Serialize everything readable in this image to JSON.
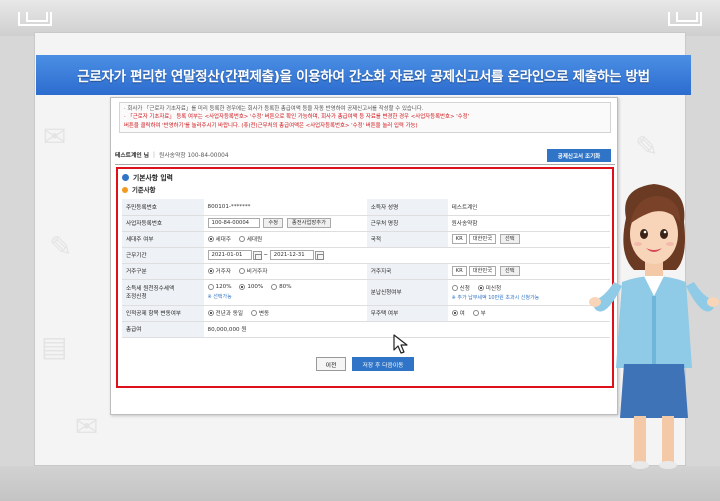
{
  "banner": {
    "title": "근로자가 편리한 연말정산(간편제출)을 이용하여 간소화 자료와 공제신고서를 온라인으로 제출하는 방법"
  },
  "notice": {
    "line1": "· 회사가 「근로자 기초자료」를 미리 등록한 경우에는 회사가 등록한 총급여액 등을 자동 반영하여 공제신고서를 작성할 수 있습니다.",
    "line2_red": "· 「근로자 기초자료」 등록 여부는 <사업자등록번호> '수정' 버튼으로 확인 가능",
    "line2_rest": "하며, 회사가 총급여액 등 자료를 변경한 경우 <사업자등록번호> '수정'",
    "line3": "버튼을 클릭하여 '반영하기'를 눌러주시기 바랍니다. (휴(전)근무처의 총급여액은 <사업자등록번호> '수정' 버튼을 눌러 입력 가능)"
  },
  "business": {
    "name": "테스트계인 님",
    "number": "원사송약함 100-84-00004",
    "button": "공제신고서 조기화"
  },
  "form": {
    "section_title": "기본사항 입력",
    "subsection_title": "기준사항",
    "rows": {
      "rrn_label": "주민등록번호",
      "rrn_value": "800101-*******",
      "company_name_label": "소득자 성명",
      "company_name_value": "테스트계인",
      "bizno_label": "사업자등록번호",
      "bizno_value": "100-84-00004",
      "edit_button": "수정",
      "add_prev_button": "종전사업장추가",
      "workplace_label": "근무처 명칭",
      "workplace_value": "원사송약함",
      "household_label": "세대주 여부",
      "household_opt1": "세대주",
      "household_opt2": "세대원",
      "nationality_label": "국적",
      "nationality_code": "KR",
      "nationality_name": "대한민국",
      "select_button": "선택",
      "period_label": "근무기간",
      "period_start": "2021-01-01",
      "period_tilde": "~",
      "period_end": "2021-12-31",
      "residence_label": "거주구분",
      "residence_opt1": "거주자",
      "residence_opt2": "비거주자",
      "residence_country_label": "거주지국",
      "residence_country_code": "KR",
      "residence_country_name": "대한민국",
      "residence_select_button": "선택",
      "tax_label_line1": "소득세 원천징수세액",
      "tax_label_line2": "조정신청",
      "tax_opt1": "120%",
      "tax_opt2": "100%",
      "tax_opt3": "80%",
      "tax_note": "※ 선택가능",
      "installment_label": "분납신청여부",
      "installment_opt1": "신청",
      "installment_opt2": "미신청",
      "installment_note": "※ 추가 납부세액 10만원 초과시 신청가능",
      "personal_deduction_label": "인적공제 항목 변동여부",
      "personal_opt1": "전년과 동일",
      "personal_opt2": "변동",
      "no_house_label": "무주택 여부",
      "no_house_opt1": "여",
      "no_house_opt2": "부",
      "total_pay_label": "총급여",
      "total_pay_value": "80,000,000",
      "total_pay_unit": "원"
    }
  },
  "buttons": {
    "prev": "이전",
    "save_next": "저장 후 다음이동"
  },
  "colors": {
    "banner_blue": "#2c6ccf",
    "highlight_red": "#e0101a",
    "button_blue": "#2f74c6"
  }
}
